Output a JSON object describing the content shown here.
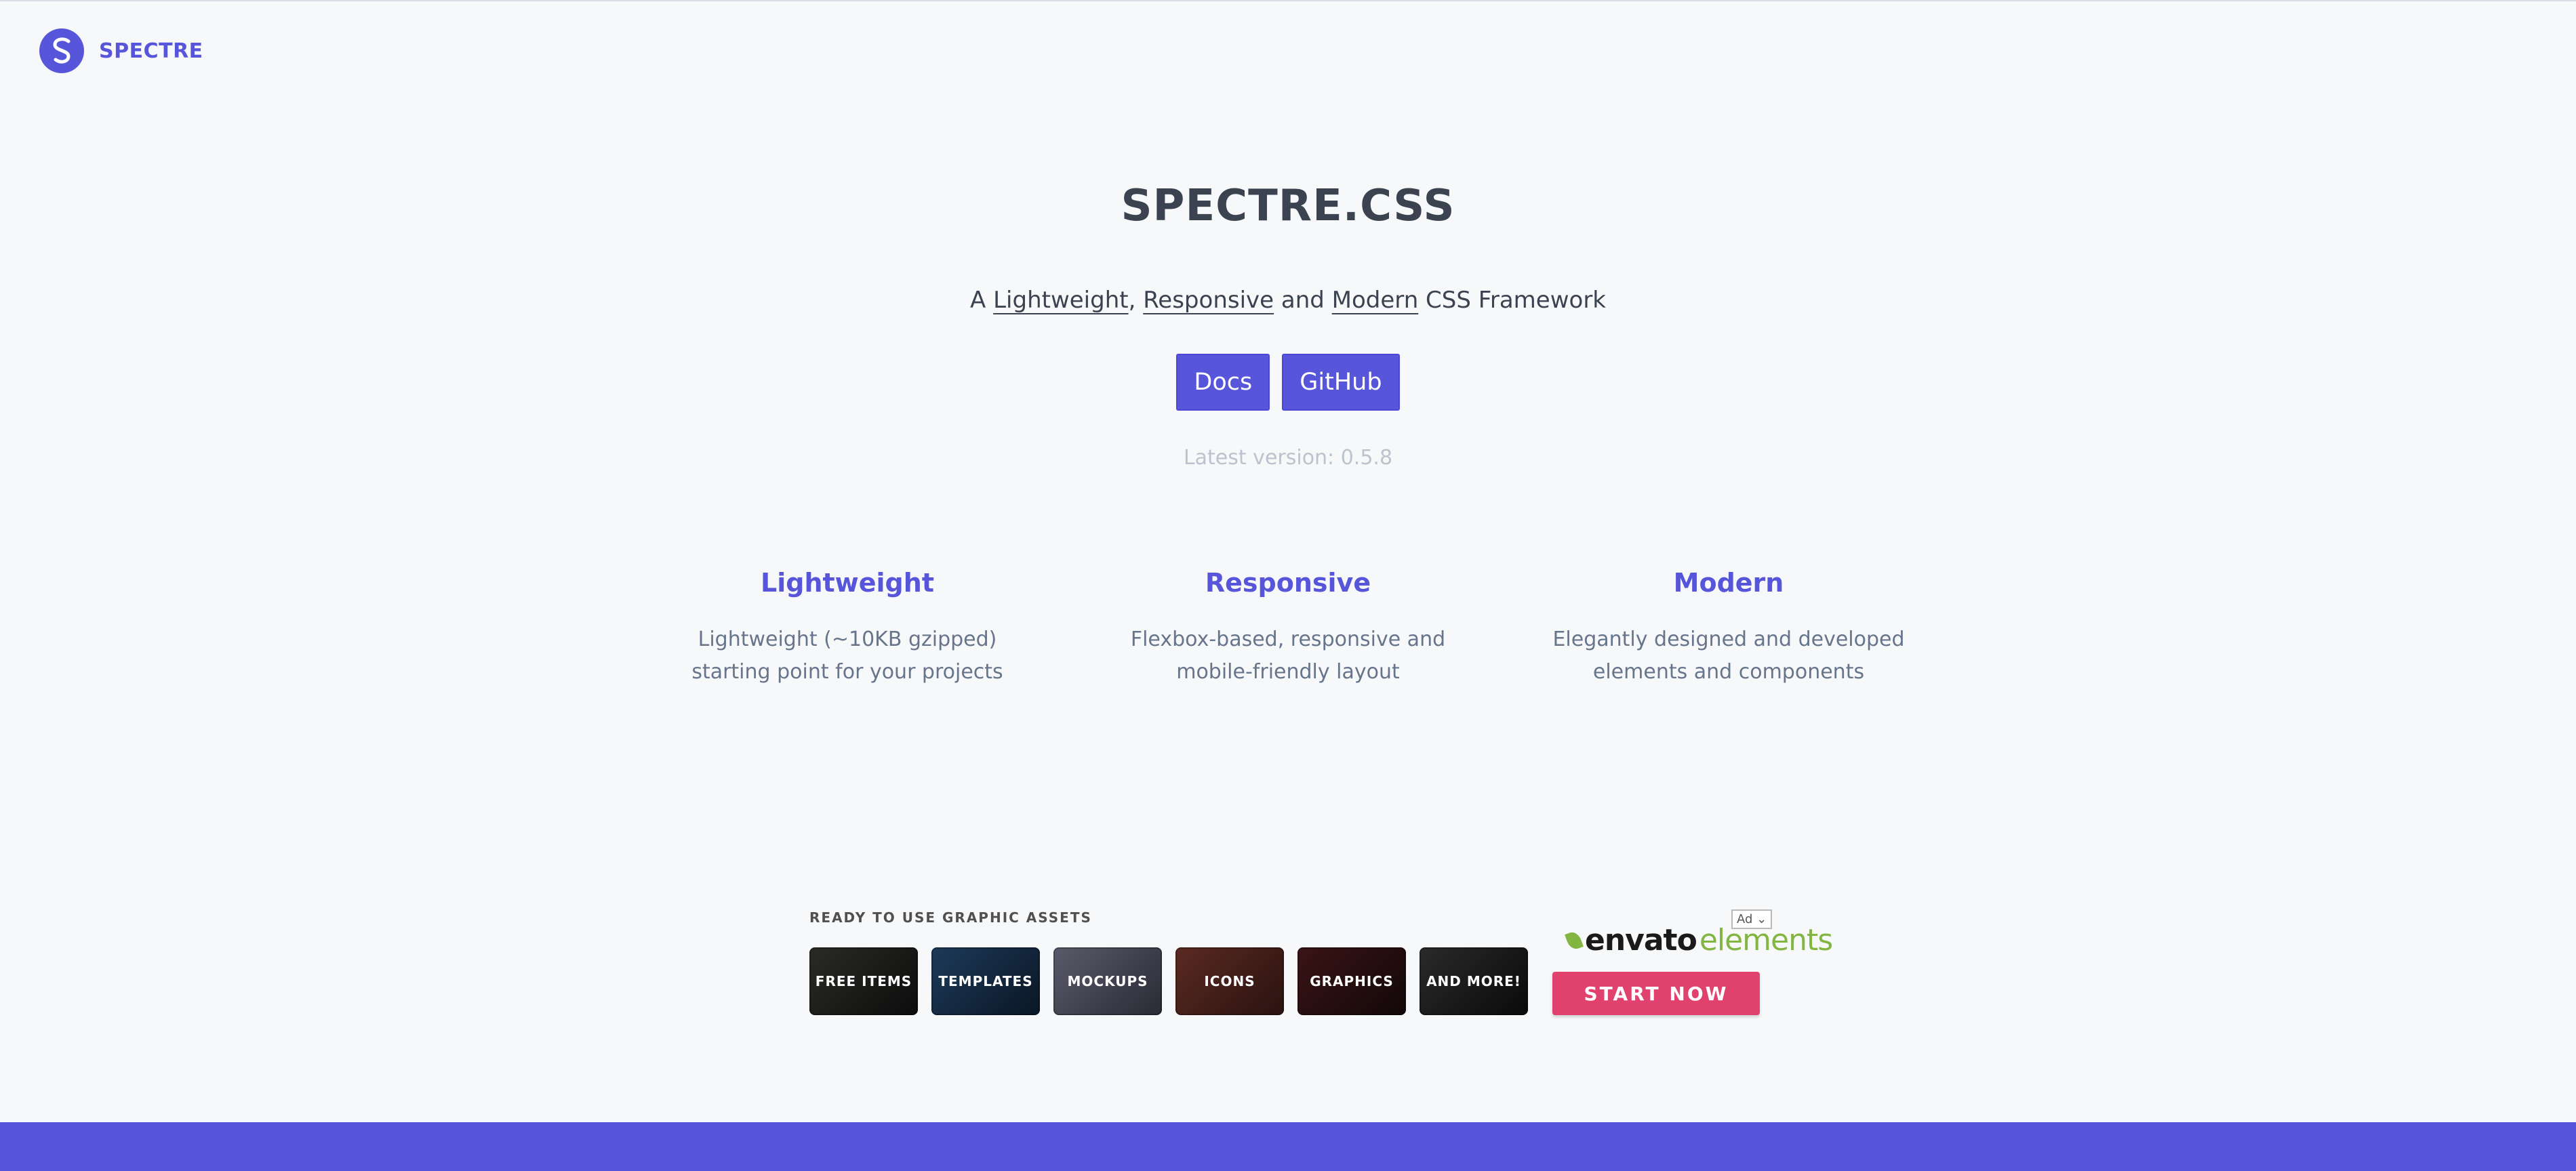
{
  "brand": {
    "name": "SPECTRE"
  },
  "hero": {
    "title": "SPECTRE.CSS",
    "subtitle": {
      "prefix": "A ",
      "link1": "Lightweight",
      "sep1": ", ",
      "link2": "Responsive",
      "sep2": " and ",
      "link3": "Modern",
      "suffix": " CSS Framework"
    },
    "buttons": {
      "docs": "Docs",
      "github": "GitHub"
    },
    "version": "Latest version: 0.5.8"
  },
  "features": [
    {
      "title": "Lightweight",
      "desc_line1": "Lightweight (~10KB gzipped)",
      "desc_line2": "starting point for your projects"
    },
    {
      "title": "Responsive",
      "desc_line1": "Flexbox-based, responsive and",
      "desc_line2": "mobile-friendly layout"
    },
    {
      "title": "Modern",
      "desc_line1": "Elegantly designed and developed",
      "desc_line2": "elements and components"
    }
  ],
  "ad": {
    "heading": "READY TO USE GRAPHIC ASSETS",
    "tiles": [
      "FREE ITEMS",
      "TEMPLATES",
      "MOCKUPS",
      "ICONS",
      "GRAPHICS",
      "AND MORE!"
    ],
    "logo_part1": "envato",
    "logo_part2": "elements",
    "badge": "Ad",
    "cta": "START NOW"
  },
  "colors": {
    "accent": "#5755d9",
    "cta": "#e0416d",
    "envato_green": "#82b541"
  }
}
